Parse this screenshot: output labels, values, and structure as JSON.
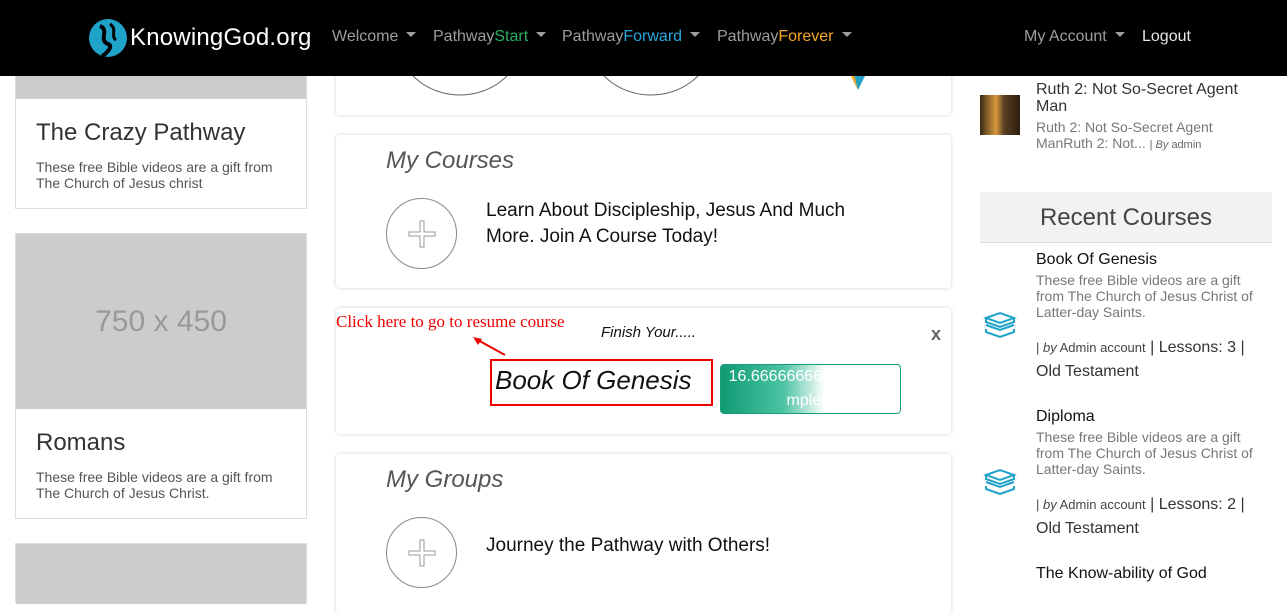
{
  "nav": {
    "logo_text": "KnowingGod.org",
    "welcome": "Welcome",
    "pathway_prefix": "Pathway",
    "start": "Start",
    "forward": "Forward",
    "forever": "Forever",
    "my_account": "My Account",
    "logout": "Logout"
  },
  "left": {
    "cards": [
      {
        "title": "The Crazy Pathway",
        "desc": "These free Bible videos are a gift from The Church of Jesus christ"
      },
      {
        "image_text": "750 x 450",
        "title": "Romans",
        "desc": "These free Bible videos are a gift from The Church of Jesus Christ."
      }
    ]
  },
  "main": {
    "my_courses": {
      "title": "My Courses",
      "text": "Learn About Discipleship, Jesus And Much More. Join A Course Today!"
    },
    "resume": {
      "link_text": "Click here to go to resume course",
      "finish_label": "Finish Your.....",
      "close": "x",
      "course": "Book Of Genesis",
      "progress_text": "16.666666666667%Complete",
      "progress_value": 16.666666666667
    },
    "my_groups": {
      "title": "My Groups",
      "text": "Journey the Pathway with Others!"
    }
  },
  "right": {
    "top_post": {
      "title": "Ruth 2: Not So-Secret Agent Man",
      "desc": "Ruth 2: Not So-Secret Agent ManRuth 2: Not...",
      "by": "By",
      "author": "admin"
    },
    "recent_courses_title": "Recent Courses",
    "courses": [
      {
        "title": "Book Of Genesis",
        "desc": "These free Bible videos are a gift from The Church of Jesus Christ of Latter-day Saints.",
        "by": "by",
        "author": "Admin account",
        "lessons": "Lessons: 3",
        "category": "Old Testament"
      },
      {
        "title": "Diploma",
        "desc": "These free Bible videos are a gift from The Church of Jesus Christ of Latter-day Saints.",
        "by": "by",
        "author": "Admin account",
        "lessons": "Lessons: 2",
        "category": "Old Testament"
      },
      {
        "title": "The Know-ability of God"
      }
    ]
  },
  "colors": {
    "navbar_bg": "#000000",
    "start": "#27ae60",
    "forward": "#29a8e0",
    "forever": "#f5a623",
    "highlight_red": "#ee0000",
    "progress": "#0f9b73",
    "book_icon": "#1fa3c9"
  }
}
